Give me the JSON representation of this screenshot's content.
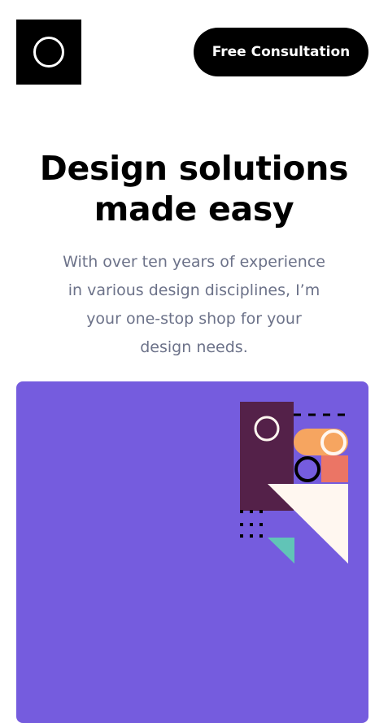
{
  "header": {
    "logo_icon": "circle-outline-logo",
    "cta_label": "Free Consultation"
  },
  "hero": {
    "title_line1": "Design solutions",
    "title_line2": "made easy",
    "subtitle_lines": [
      "With over ten years of experience",
      "in various design disciplines, I’m",
      "your one-stop shop for your",
      "design needs."
    ]
  },
  "colors": {
    "accent_purple": "#755cde",
    "dark_plum": "#542149",
    "peach": "#f6a560",
    "coral": "#eb7565",
    "cream": "#fff7f0",
    "teal": "#61c4b7",
    "text_muted": "#6c7289"
  }
}
